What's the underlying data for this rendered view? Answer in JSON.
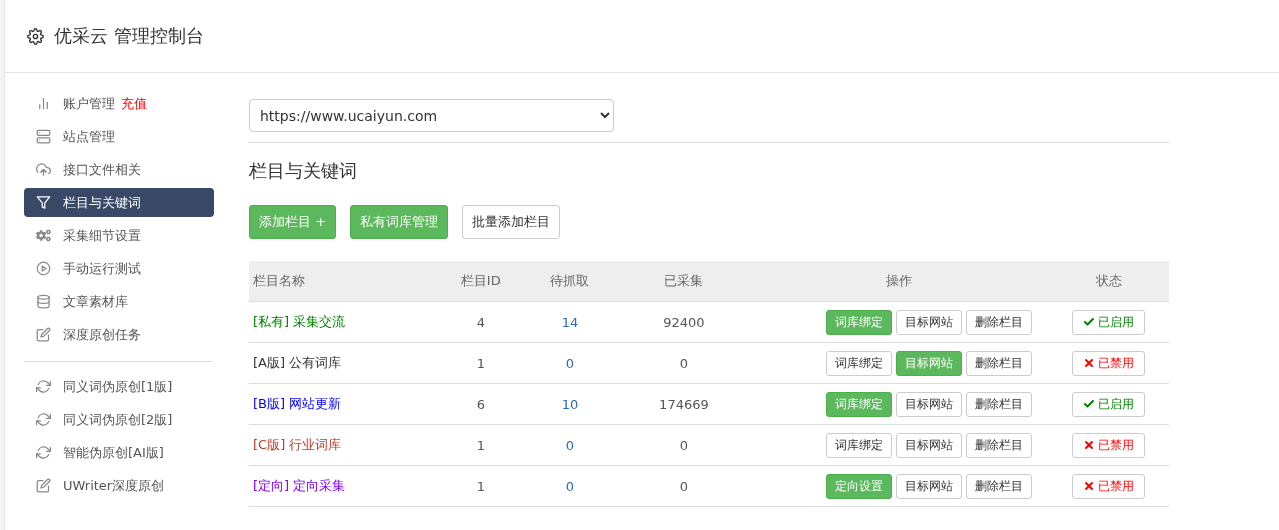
{
  "header": {
    "title": "优采云 管理控制台"
  },
  "sidebar": {
    "groups": [
      [
        {
          "label": "账户管理",
          "badge": "充值",
          "kind": "chart",
          "selected": false
        },
        {
          "label": "站点管理",
          "kind": "server",
          "selected": false
        },
        {
          "label": "接口文件相关",
          "kind": "cloud",
          "selected": false
        },
        {
          "label": "栏目与关键词",
          "kind": "filter",
          "selected": true
        },
        {
          "label": "采集细节设置",
          "kind": "gears",
          "selected": false
        },
        {
          "label": "手动运行测试",
          "kind": "play",
          "selected": false
        },
        {
          "label": "文章素材库",
          "kind": "database",
          "selected": false
        },
        {
          "label": "深度原创任务",
          "kind": "edit",
          "selected": false
        }
      ],
      [
        {
          "label": "同义词伪原创[1版]",
          "kind": "refresh",
          "selected": false
        },
        {
          "label": "同义词伪原创[2版]",
          "kind": "refresh",
          "selected": false
        },
        {
          "label": "智能伪原创[AI版]",
          "kind": "refresh",
          "selected": false
        },
        {
          "label": "UWriter深度原创",
          "kind": "edit",
          "selected": false
        }
      ]
    ]
  },
  "site_select": {
    "value": "https://www.ucaiyun.com"
  },
  "section_title": "栏目与关键词",
  "toolbar": [
    {
      "label": "添加栏目 +",
      "kind": "primary"
    },
    {
      "label": "私有词库管理",
      "kind": "primary"
    },
    {
      "label": "批量添加栏目",
      "kind": "default"
    }
  ],
  "table": {
    "columns": [
      "栏目名称",
      "栏目ID",
      "待抓取",
      "已采集",
      "操作",
      "状态"
    ],
    "rows": [
      {
        "tag": "[私有]",
        "name": "采集交流",
        "color": "#008000",
        "id": "4",
        "pending": "14",
        "collected": "92400",
        "actions": [
          {
            "label": "词库绑定",
            "kind": "primary"
          },
          {
            "label": "目标网站",
            "kind": "default"
          },
          {
            "label": "删除栏目",
            "kind": "default"
          }
        ],
        "status": {
          "label": "已启用",
          "enabled": true
        }
      },
      {
        "tag": "[A版]",
        "name": "公有词库",
        "color": "#333333",
        "id": "1",
        "pending": "0",
        "collected": "0",
        "actions": [
          {
            "label": "词库绑定",
            "kind": "default"
          },
          {
            "label": "目标网站",
            "kind": "primary"
          },
          {
            "label": "删除栏目",
            "kind": "default"
          }
        ],
        "status": {
          "label": "已禁用",
          "enabled": false
        }
      },
      {
        "tag": "[B版]",
        "name": "网站更新",
        "color": "#0000ff",
        "id": "6",
        "pending": "10",
        "collected": "174669",
        "actions": [
          {
            "label": "词库绑定",
            "kind": "primary"
          },
          {
            "label": "目标网站",
            "kind": "default"
          },
          {
            "label": "删除栏目",
            "kind": "default"
          }
        ],
        "status": {
          "label": "已启用",
          "enabled": true
        }
      },
      {
        "tag": "[C版]",
        "name": "行业词库",
        "color": "#c0392b",
        "id": "1",
        "pending": "0",
        "collected": "0",
        "actions": [
          {
            "label": "词库绑定",
            "kind": "default"
          },
          {
            "label": "目标网站",
            "kind": "default"
          },
          {
            "label": "删除栏目",
            "kind": "default"
          }
        ],
        "status": {
          "label": "已禁用",
          "enabled": false
        }
      },
      {
        "tag": "[定向]",
        "name": "定向采集",
        "color": "#8000ff",
        "id": "1",
        "pending": "0",
        "collected": "0",
        "actions": [
          {
            "label": "定向设置",
            "kind": "primary"
          },
          {
            "label": "目标网站",
            "kind": "default"
          },
          {
            "label": "删除栏目",
            "kind": "default"
          }
        ],
        "status": {
          "label": "已禁用",
          "enabled": false
        }
      }
    ]
  }
}
